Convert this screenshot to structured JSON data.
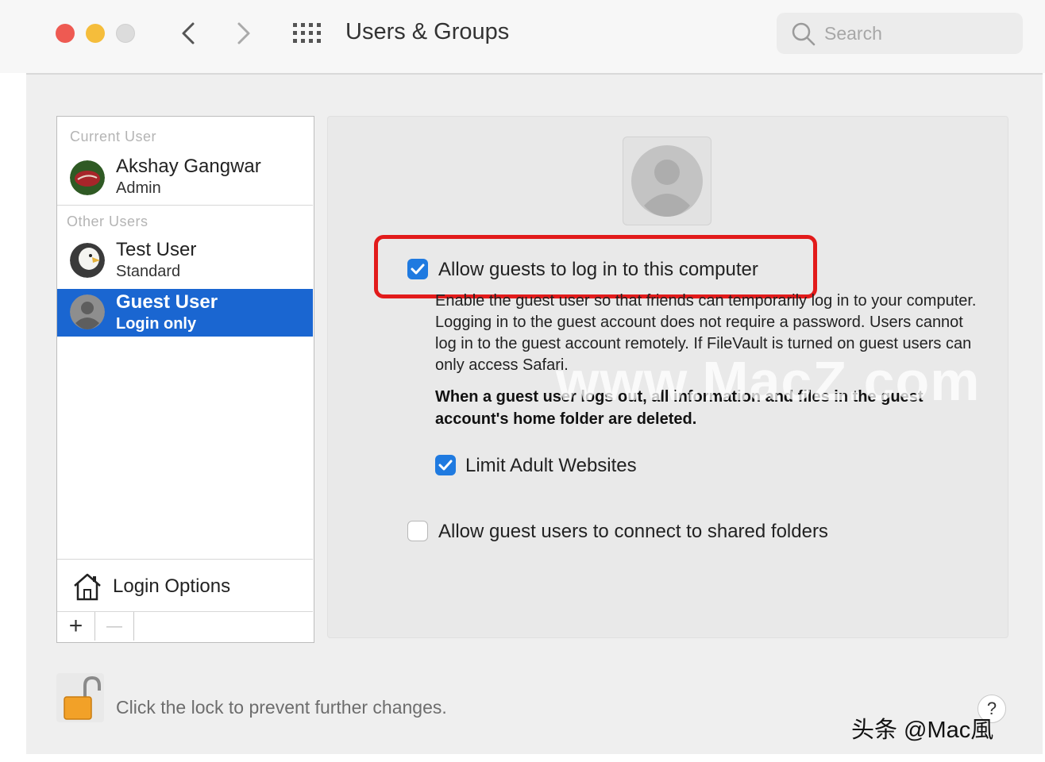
{
  "window": {
    "title": "Users & Groups",
    "search_placeholder": "Search"
  },
  "sidebar": {
    "current_label": "Current User",
    "current_user": {
      "name": "Akshay Gangwar",
      "role": "Admin"
    },
    "other_label": "Other Users",
    "other_users": [
      {
        "name": "Test User",
        "role": "Standard"
      },
      {
        "name": "Guest User",
        "role": "Login only",
        "selected": true
      }
    ],
    "login_options": "Login Options",
    "add_symbol": "+",
    "remove_symbol": "—"
  },
  "guest_pane": {
    "allow_guests": {
      "label": "Allow guests to log in to this computer",
      "checked": true
    },
    "description": "Enable the guest user so that friends can temporarily log in to your computer. Logging in to the guest account does not require a password. Users cannot log in to the guest account remotely. If FileVault is turned on guest users can only access Safari.",
    "warning": "When a guest user logs out, all information and files in the guest account's home folder are deleted.",
    "limit_adult": {
      "label": "Limit Adult Websites",
      "checked": true
    },
    "shared_folders": {
      "label": "Allow guest users to connect to shared folders",
      "checked": false
    }
  },
  "footer": {
    "lock_text": "Click the lock to prevent further changes.",
    "help": "?"
  },
  "watermark": {
    "site": "www.MacZ.com",
    "credit": "头条 @Mac風"
  },
  "colors": {
    "selection": "#1a66d1",
    "checkbox": "#1f7ae0",
    "highlight": "#e21b1b"
  }
}
